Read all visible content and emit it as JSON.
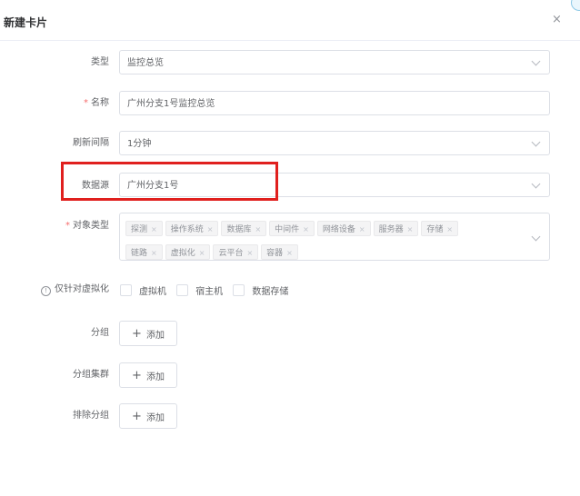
{
  "dialog": {
    "title": "新建卡片",
    "close_icon": "×"
  },
  "form": {
    "type": {
      "label": "类型",
      "value": "监控总览"
    },
    "name": {
      "required_mark": "*",
      "label": "名称",
      "value": "广州分支1号监控总览"
    },
    "refresh": {
      "label": "刷新间隔",
      "value": "1分钟"
    },
    "datasource": {
      "label": "数据源",
      "value": "广州分支1号"
    },
    "object_type": {
      "required_mark": "*",
      "label": "对象类型",
      "tags": [
        "探测",
        "操作系统",
        "数据库",
        "中间件",
        "网络设备",
        "服务器",
        "存储",
        "链路",
        "虚拟化",
        "云平台",
        "容器"
      ],
      "tag_close": "×"
    },
    "virtual_only": {
      "info_icon": "!",
      "label": "仅针对虚拟化",
      "options": [
        "虚拟机",
        "宿主机",
        "数据存储"
      ]
    },
    "group": {
      "label": "分组",
      "button": "添加"
    },
    "group_cluster": {
      "label": "分组集群",
      "button": "添加"
    },
    "exclude_group": {
      "label": "排除分组",
      "button": "添加"
    },
    "add_icon": "+"
  },
  "colors": {
    "highlight": "#e0201e",
    "required": "#f56c6c"
  }
}
